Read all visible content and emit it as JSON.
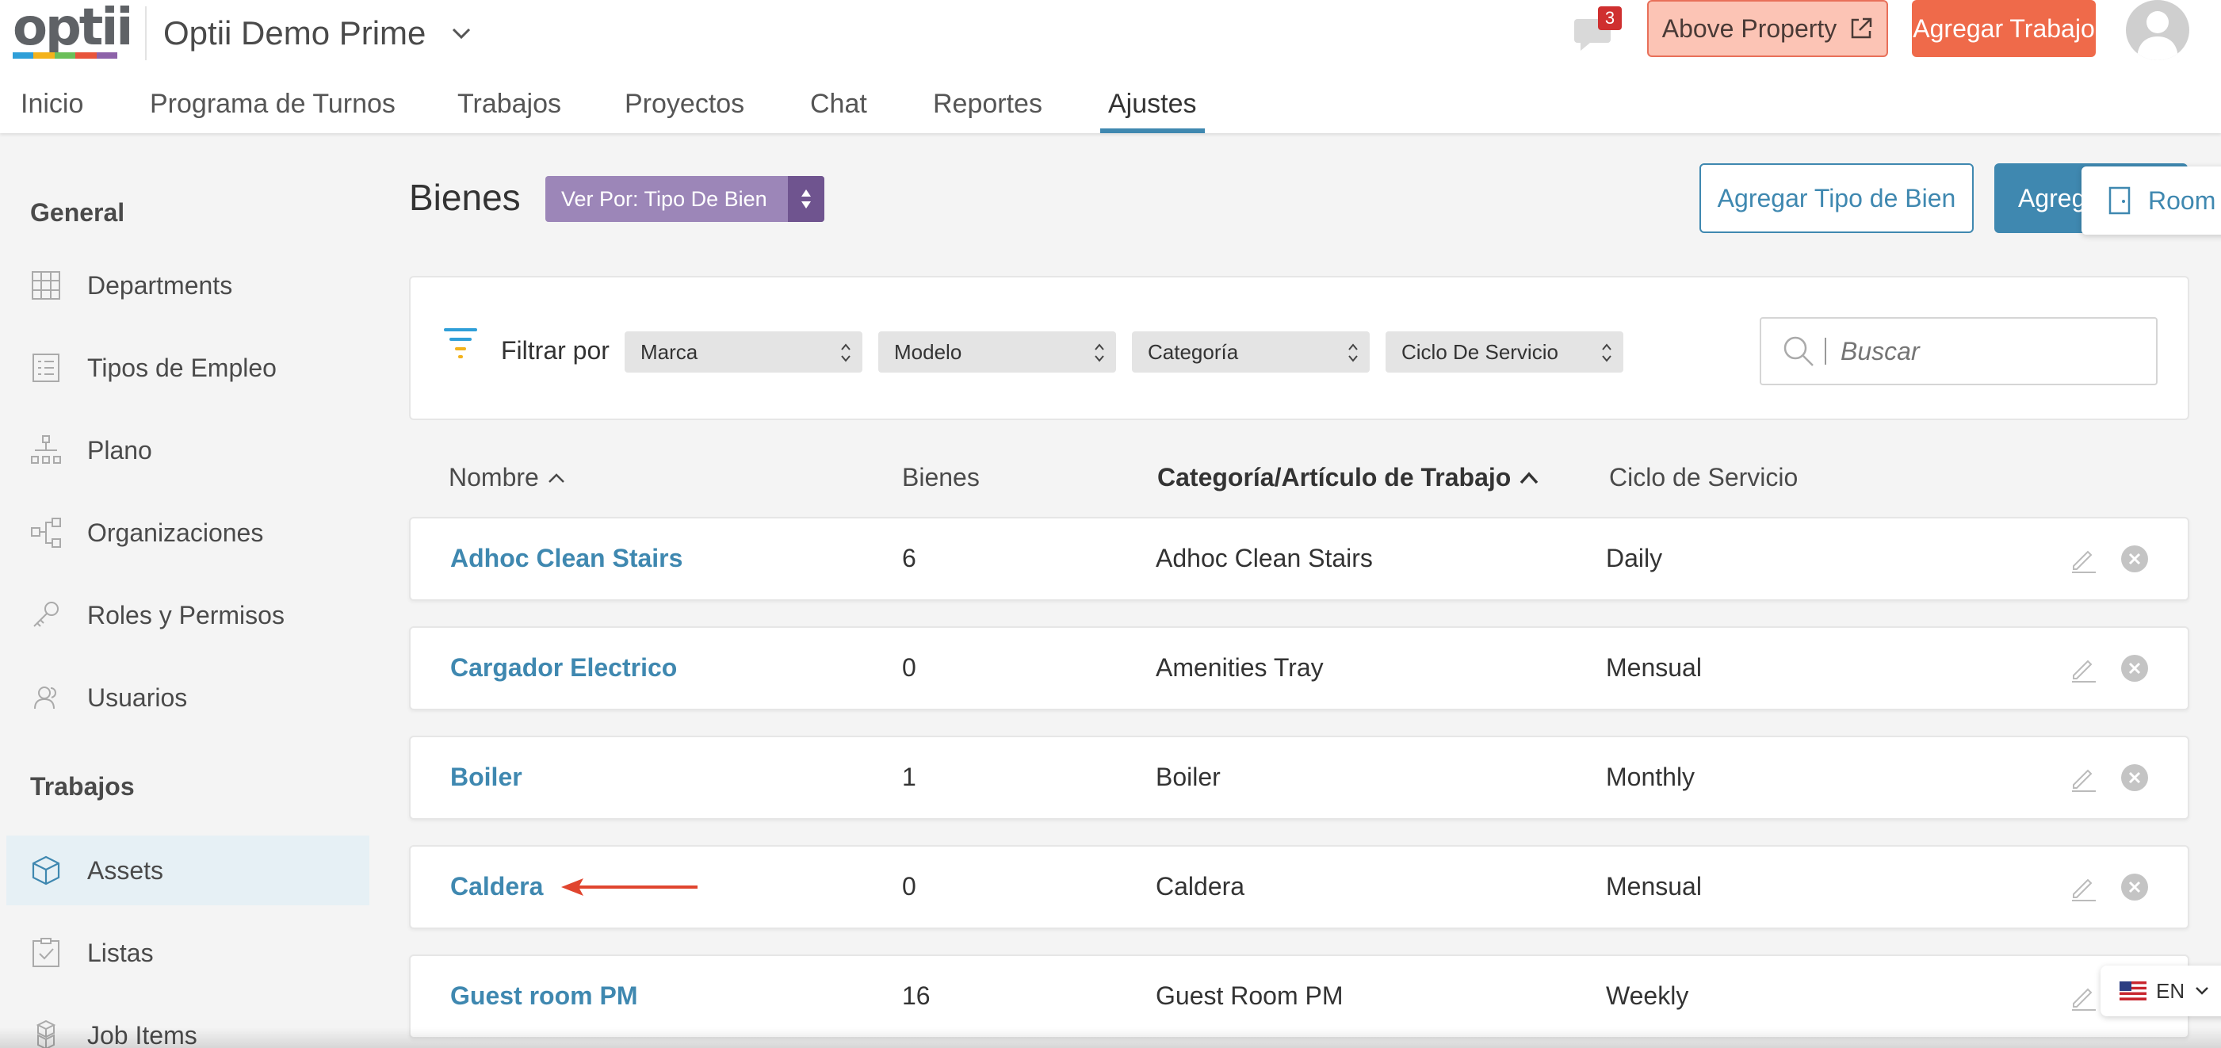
{
  "brand": {
    "logo_text": "optii",
    "logo_colors": [
      "#2f9fd8",
      "#f3b21b",
      "#6bbf59",
      "#e8543b",
      "#8d62a9"
    ],
    "accent": "#3f88b0",
    "orange": "#ef6a4a"
  },
  "header": {
    "property_name": "Optii Demo Prime",
    "chat_count": "3",
    "above_property_label": "Above Property",
    "add_job_label": "Agregar Trabajo"
  },
  "nav": {
    "items": [
      "Inicio",
      "Programa de Turnos",
      "Trabajos",
      "Proyectos",
      "Chat",
      "Reportes",
      "Ajustes"
    ],
    "active": "Ajustes"
  },
  "sidebar": {
    "general_title": "General",
    "general_items": [
      {
        "label": "Departments",
        "icon": "grid-icon"
      },
      {
        "label": "Tipos de Empleo",
        "icon": "list-icon"
      },
      {
        "label": "Plano",
        "icon": "floorplan-icon"
      },
      {
        "label": "Organizaciones",
        "icon": "org-icon"
      },
      {
        "label": "Roles y Permisos",
        "icon": "key-icon"
      },
      {
        "label": "Usuarios",
        "icon": "users-icon"
      }
    ],
    "jobs_title": "Trabajos",
    "jobs_items": [
      {
        "label": "Assets",
        "icon": "cube-icon",
        "active": true
      },
      {
        "label": "Listas",
        "icon": "checklist-icon"
      },
      {
        "label": "Job Items",
        "icon": "boxes-icon"
      }
    ]
  },
  "main": {
    "title": "Bienes",
    "view_by_label": "Ver Por: Tipo De Bien",
    "add_type_label": "Agregar Tipo de Bien",
    "add_primary_label": "Agregar",
    "rooms_label": "Room",
    "filter": {
      "label": "Filtrar por",
      "selects": [
        "Marca",
        "Modelo",
        "Categoría",
        "Ciclo De Servicio"
      ],
      "search_placeholder": "Buscar"
    },
    "columns": [
      "Nombre",
      "Bienes",
      "Categoría/Artículo de Trabajo",
      "Ciclo de Servicio"
    ],
    "rows": [
      {
        "name": "Adhoc Clean Stairs",
        "count": "6",
        "category": "Adhoc Clean Stairs",
        "cycle": "Daily"
      },
      {
        "name": "Cargador Electrico",
        "count": "0",
        "category": "Amenities Tray",
        "cycle": "Mensual"
      },
      {
        "name": "Boiler",
        "count": "1",
        "category": "Boiler",
        "cycle": "Monthly"
      },
      {
        "name": "Caldera",
        "count": "0",
        "category": "Caldera",
        "cycle": "Mensual"
      },
      {
        "name": "Guest room PM",
        "count": "16",
        "category": "Guest Room PM",
        "cycle": "Weekly"
      }
    ]
  },
  "language": {
    "code": "EN"
  }
}
